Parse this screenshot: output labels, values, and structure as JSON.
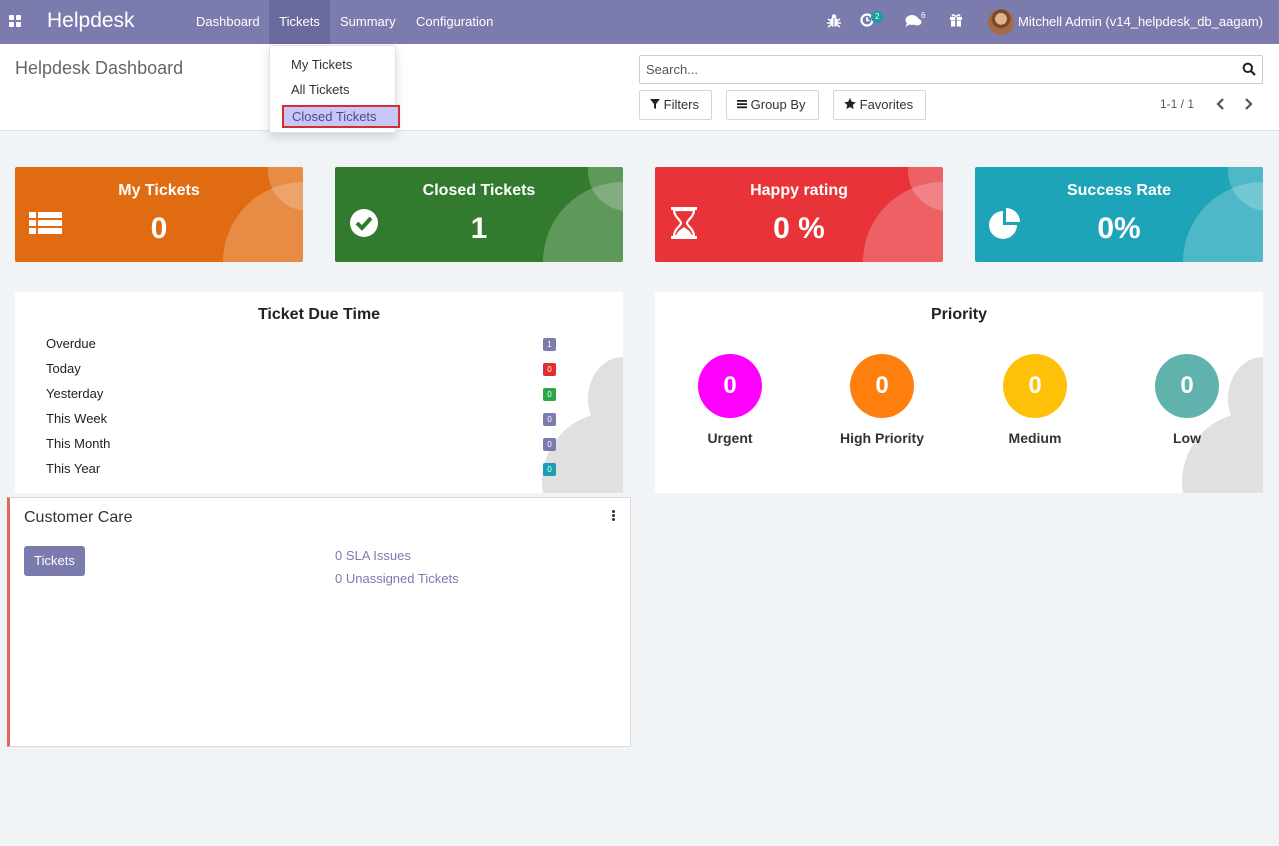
{
  "app": {
    "brand": "Helpdesk",
    "menu": [
      "Dashboard",
      "Tickets",
      "Summary",
      "Configuration"
    ],
    "active_menu": "Tickets",
    "activity_badge": "2",
    "messages_badge": "6",
    "user_name": "Mitchell Admin (v14_helpdesk_db_aagam)",
    "icons": [
      "apps-icon",
      "bug-icon",
      "activity-clock-icon",
      "chat-icon",
      "gift-icon"
    ]
  },
  "tickets_dropdown": {
    "items": [
      "My Tickets",
      "All Tickets",
      "Closed Tickets"
    ],
    "highlighted": "Closed Tickets"
  },
  "control_panel": {
    "breadcrumb": "Helpdesk Dashboard",
    "search_placeholder": "Search...",
    "filters_label": "Filters",
    "group_by_label": "Group By",
    "favorites_label": "Favorites",
    "pager": "1-1 / 1"
  },
  "stat_cards": [
    {
      "title": "My Tickets",
      "value": "0",
      "color": "#e06b11",
      "icon": "list-icon"
    },
    {
      "title": "Closed Tickets",
      "value": "1",
      "color": "#327b2e",
      "icon": "check-circle-icon"
    },
    {
      "title": "Happy rating",
      "value": "0 %",
      "color": "#e83439",
      "icon": "hourglass-icon"
    },
    {
      "title": "Success Rate",
      "value": "0%",
      "color": "#1ea4b8",
      "icon": "pie-chart-icon"
    }
  ],
  "due_time": {
    "title": "Ticket Due Time",
    "rows": [
      {
        "label": "Overdue",
        "count": "1",
        "color": "#7c7bad"
      },
      {
        "label": "Today",
        "count": "0",
        "color": "#e02d2d"
      },
      {
        "label": "Yesterday",
        "count": "0",
        "color": "#28a745"
      },
      {
        "label": "This Week",
        "count": "0",
        "color": "#7c7bad"
      },
      {
        "label": "This Month",
        "count": "0",
        "color": "#7c7bad"
      },
      {
        "label": "This Year",
        "count": "0",
        "color": "#1a9eb0"
      }
    ]
  },
  "priority": {
    "title": "Priority",
    "items": [
      {
        "label": "Urgent",
        "value": "0",
        "color": "#ff00ff"
      },
      {
        "label": "High Priority",
        "value": "0",
        "color": "#ff7f0e"
      },
      {
        "label": "Medium",
        "value": "0",
        "color": "#ffc107"
      },
      {
        "label": "Low",
        "value": "0",
        "color": "#5fb3ac"
      }
    ]
  },
  "team": {
    "name": "Customer Care",
    "tickets_button": "Tickets",
    "sla_issues": "0 SLA Issues",
    "unassigned": "0 Unassigned Tickets"
  }
}
